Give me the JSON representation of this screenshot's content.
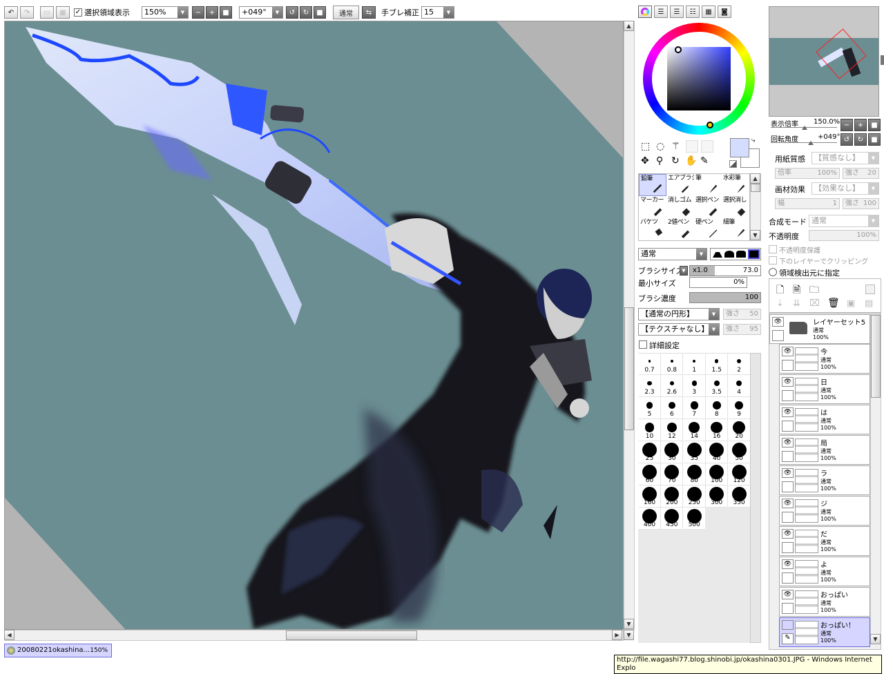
{
  "toolbar": {
    "show_selection_label": "選択領域表示",
    "show_selection_checked": true,
    "zoom_value": "150%",
    "rotation_value": "+049°",
    "blend_label": "通常",
    "stabilizer_label": "手ブレ補正",
    "stabilizer_value": "15"
  },
  "navigator": {
    "zoom_label": "表示倍率",
    "zoom_value": "150.0%",
    "rotate_label": "回転角度",
    "rotate_value": "+049°"
  },
  "paper": {
    "texture_label": "用紙質感",
    "texture_value": "【質感なし】",
    "scale_label": "倍率",
    "scale_value": "100%",
    "strength_label": "強さ",
    "strength_value": "20",
    "effect_label": "画材効果",
    "effect_value": "【効果なし】",
    "width_label": "幅",
    "width_value": "1",
    "effect_strength_label": "強さ",
    "effect_strength_value": "100"
  },
  "layer_props": {
    "blend_label": "合成モード",
    "blend_value": "通常",
    "opacity_label": "不透明度",
    "opacity_value": "100%",
    "protect_label": "不透明度保護",
    "clip_label": "下のレイヤーでクリッピング",
    "source_label": "領域検出元に指定"
  },
  "tools": [
    {
      "label": "鉛筆",
      "icon": "pencil-icon",
      "selected": true
    },
    {
      "label": "エアブラシ",
      "icon": "airbrush-icon",
      "selected": false
    },
    {
      "label": "筆",
      "icon": "brush-icon",
      "selected": false
    },
    {
      "label": "水彩筆",
      "icon": "watercolor-icon",
      "selected": false
    },
    {
      "label": "マーカー",
      "icon": "marker-icon",
      "selected": false
    },
    {
      "label": "消しゴム",
      "icon": "eraser-icon",
      "selected": false
    },
    {
      "label": "選択ペン",
      "icon": "select-pen-icon",
      "selected": false
    },
    {
      "label": "選択消し",
      "icon": "select-eraser-icon",
      "selected": false
    },
    {
      "label": "バケツ",
      "icon": "bucket-icon",
      "selected": false
    },
    {
      "label": "2値ペン",
      "icon": "binary-pen-icon",
      "selected": false
    },
    {
      "label": "硬ペン",
      "icon": "hard-pen-icon",
      "selected": false
    },
    {
      "label": "細筆",
      "icon": "fine-brush-icon",
      "selected": false
    }
  ],
  "brush": {
    "mode_value": "通常",
    "size_label": "ブラシサイズ",
    "size_mult": "x1.0",
    "size_value": "73.0",
    "size_fraction": 0.35,
    "min_size_label": "最小サイズ",
    "min_size_value": "0%",
    "density_label": "ブラシ濃度",
    "density_value": "100",
    "density_fraction": 1.0,
    "shape_value": "【通常の円形】",
    "shape_strength_label": "強さ",
    "shape_strength_value": "50",
    "texture_value": "【テクスチャなし】",
    "texture_strength_label": "強さ",
    "texture_strength_value": "95",
    "detail_label": "詳細設定"
  },
  "sizes": [
    "0.7",
    "0.8",
    "1",
    "1.5",
    "2",
    "2.3",
    "2.6",
    "3",
    "3.5",
    "4",
    "5",
    "6",
    "7",
    "8",
    "9",
    "10",
    "12",
    "14",
    "16",
    "20",
    "25",
    "30",
    "35",
    "40",
    "50",
    "60",
    "70",
    "80",
    "100",
    "120",
    "160",
    "200",
    "250",
    "300",
    "350",
    "400",
    "450",
    "500"
  ],
  "layers": [
    {
      "name": "レイヤーセット5",
      "mode": "通常",
      "opacity": "100%",
      "folder": true,
      "selected": false
    },
    {
      "name": "今",
      "mode": "通常",
      "opacity": "100%",
      "folder": false,
      "selected": false
    },
    {
      "name": "日",
      "mode": "通常",
      "opacity": "100%",
      "folder": false,
      "selected": false
    },
    {
      "name": "は",
      "mode": "通常",
      "opacity": "100%",
      "folder": false,
      "selected": false
    },
    {
      "name": "局",
      "mode": "通常",
      "opacity": "100%",
      "folder": false,
      "selected": false
    },
    {
      "name": "ラ",
      "mode": "通常",
      "opacity": "100%",
      "folder": false,
      "selected": false
    },
    {
      "name": "ジ",
      "mode": "通常",
      "opacity": "100%",
      "folder": false,
      "selected": false
    },
    {
      "name": "だ",
      "mode": "通常",
      "opacity": "100%",
      "folder": false,
      "selected": false
    },
    {
      "name": "よ",
      "mode": "通常",
      "opacity": "100%",
      "folder": false,
      "selected": false
    },
    {
      "name": "おっぱい",
      "mode": "通常",
      "opacity": "100%",
      "folder": false,
      "selected": false
    },
    {
      "name": "おっぱい！",
      "mode": "通常",
      "opacity": "100%",
      "folder": false,
      "selected": true
    }
  ],
  "taskbar": {
    "doc_name": "20080221okashina...",
    "doc_zoom": "150%"
  },
  "tooltip": "http://file.wagashi77.blog.shinobi.jp/okashina0301.JPG - Windows Internet Explo",
  "colors": {
    "canvas_bg": "#6b8e92",
    "outside": "#b4b4b4",
    "current_color": "#d5ddff",
    "accent_selected": "#d5d5ff"
  }
}
